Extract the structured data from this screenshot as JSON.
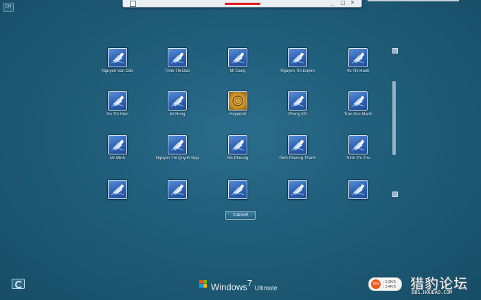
{
  "taskbar": {
    "close_glyph": "✕",
    "restore_glyph": "□",
    "minimize_glyph": "_"
  },
  "language_indicator": "CH",
  "users": [
    {
      "name": "Nguyen Van Dan",
      "picture": "user-default"
    },
    {
      "name": "Trinh Thi Dao",
      "picture": "user-default"
    },
    {
      "name": "Mr Dung",
      "picture": "user-default"
    },
    {
      "name": "Nguyen Thi Duyen",
      "picture": "user-default"
    },
    {
      "name": "Vu Thi Hanh",
      "picture": "user-default"
    },
    {
      "name": "Do Thi Hien",
      "picture": "user-default"
    },
    {
      "name": "Mr Hung",
      "picture": "user-default"
    },
    {
      "name": "Huyenntt",
      "picture": "user-gold"
    },
    {
      "name": "Phong KD",
      "picture": "user-default"
    },
    {
      "name": "Tran Duc Manh",
      "picture": "user-default"
    },
    {
      "name": "Mr Minh",
      "picture": "user-default"
    },
    {
      "name": "Nguyen Thi Quynh Nga",
      "picture": "user-default"
    },
    {
      "name": "Ms Phuong",
      "picture": "user-default"
    },
    {
      "name": "Dinh Phuong Thanh",
      "picture": "user-default"
    },
    {
      "name": "Trinh Thi Thu",
      "picture": "user-default"
    },
    {
      "name": "",
      "picture": "user-default"
    },
    {
      "name": "",
      "picture": "user-default"
    },
    {
      "name": "",
      "picture": "user-default"
    },
    {
      "name": "",
      "picture": "user-default"
    },
    {
      "name": "",
      "picture": "user-default"
    }
  ],
  "cancel_label": "Cancel",
  "branding": {
    "product": "Windows",
    "version": "7",
    "edition": "Ultimate"
  },
  "network_widget": {
    "percent": "76%",
    "upload": "5.3K/S",
    "download": "3.4K/S",
    "accent": "#ef5a1c"
  },
  "watermark": {
    "text": "猎豹论坛",
    "url": "BBS.HOUDAO.COM"
  },
  "colors": {
    "background": "#1e5b78",
    "tile_blue": "#2f64b6",
    "tile_gold": "#c89228"
  }
}
